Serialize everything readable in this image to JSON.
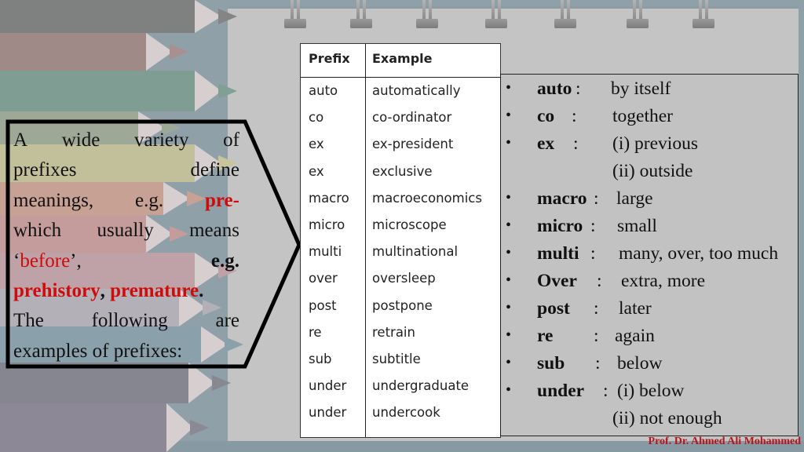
{
  "callout": {
    "lines": [
      [
        "A",
        "wide",
        "variety",
        "of"
      ],
      [
        "prefixes",
        "define"
      ],
      [
        "meanings,",
        "e.g."
      ],
      [
        "which",
        "usually",
        "means"
      ],
      [
        "The",
        "following",
        "are"
      ]
    ],
    "pre_highlight": "pre-",
    "before_open_quote": "‘",
    "before_word": "before",
    "before_close": "’,",
    "eg_bold": "e.g.",
    "example1": "prehistory",
    "comma": ", ",
    "example2": "premature",
    "period": ".",
    "last_line": "examples of prefixes:"
  },
  "table": {
    "headers": {
      "prefix": "Prefix",
      "example": "Example"
    },
    "rows": [
      {
        "prefix": "auto",
        "example": "automatically"
      },
      {
        "prefix": "co",
        "example": "co-ordinator"
      },
      {
        "prefix": "ex",
        "example": "ex-president"
      },
      {
        "prefix": "ex",
        "example": "exclusive"
      },
      {
        "prefix": "macro",
        "example": "macroeconomics"
      },
      {
        "prefix": "micro",
        "example": "microscope"
      },
      {
        "prefix": "multi",
        "example": "multinational"
      },
      {
        "prefix": "over",
        "example": "oversleep"
      },
      {
        "prefix": "post",
        "example": "postpone"
      },
      {
        "prefix": "re",
        "example": "retrain"
      },
      {
        "prefix": "sub",
        "example": "subtitle"
      },
      {
        "prefix": "under",
        "example": "undergraduate"
      },
      {
        "prefix": "under",
        "example": "undercook"
      }
    ]
  },
  "meanings": {
    "bullet": "•",
    "items": [
      {
        "term": "auto",
        "colon": ":",
        "def": "by itself"
      },
      {
        "term": "co",
        "colon": ":",
        "def": "together"
      },
      {
        "term": "ex",
        "colon": ":",
        "def": "(i) previous"
      },
      {
        "term": "",
        "colon": "",
        "def": "(ii) outside"
      },
      {
        "term": "macro",
        "colon": ":",
        "def": "large"
      },
      {
        "term": "micro",
        "colon": ":",
        "def": "small"
      },
      {
        "term": "multi",
        "colon": ":",
        "def": "many, over, too much"
      },
      {
        "term": "Over",
        "colon": ":",
        "def": "extra, more"
      },
      {
        "term": "post",
        "colon": ":",
        "def": "later"
      },
      {
        "term": "re",
        "colon": ":",
        "def": "again"
      },
      {
        "term": "sub",
        "colon": ":",
        "def": "below"
      },
      {
        "term": "under",
        "colon": ":",
        "def": "(i) below"
      },
      {
        "term": "",
        "colon": "",
        "def": "(ii) not enough"
      }
    ]
  },
  "author": "Prof. Dr. Ahmed Ali Mohammed",
  "colors": {
    "highlight_red": "#d10a0a",
    "author_red": "#b8141a",
    "page_gray": "#c4c4c4",
    "frame_blue_gray": "#8fa0a8"
  }
}
